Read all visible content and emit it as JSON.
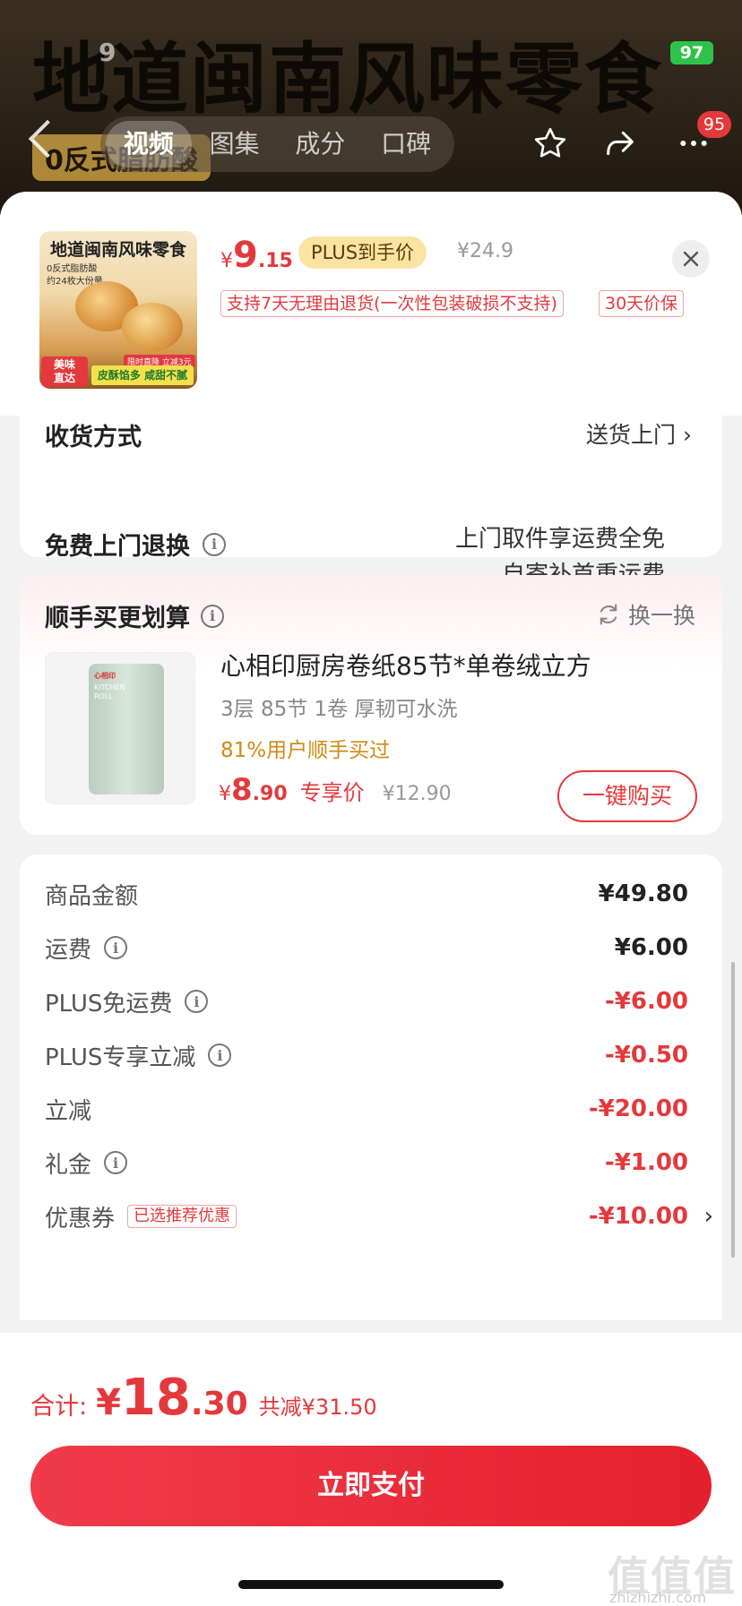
{
  "background": {
    "headline": "地道闽南风味零食",
    "subtag": "0反式脂肪酸",
    "status_time": "9",
    "battery": "97"
  },
  "nav": {
    "tabs": [
      {
        "label": "视频",
        "active": true
      },
      {
        "label": "图集",
        "active": false
      },
      {
        "label": "成分",
        "active": false
      },
      {
        "label": "口碑",
        "active": false
      }
    ],
    "badge_count": "95",
    "icons": [
      "back-icon",
      "star-icon",
      "share-icon",
      "more-icon"
    ]
  },
  "product": {
    "thumb_title": "地道闽南风味零食",
    "thumb_sub": "0反式脂肪酸\n约24枚大份量",
    "thumb_badge": "美味\n直达",
    "thumb_promo": "限时直降 立减3元",
    "thumb_foot": "皮酥馅多 咸甜不腻",
    "currency": "¥",
    "price_int": "9",
    "price_dec": ".15",
    "plus_tag": "PLUS到手价",
    "orig_price": "¥24.9",
    "policy_tags": [
      "支持7天无理由退货(一次性包装破损不支持)",
      "30天价保"
    ]
  },
  "shipping": {
    "cut_label": "收货方式",
    "cut_value": "送货上门 ›",
    "return_title": "免费上门退换",
    "return_lines": [
      "上门取件享运费全免",
      "自寄补首重运费"
    ]
  },
  "addon": {
    "title": "顺手买更划算",
    "swap_label": "换一换",
    "img_brand": "心相印",
    "img_label": "KITCHEN\nROLL",
    "name": "心相印厨房卷纸85节*单卷绒立方",
    "spec": "3层 85节 1卷 厚韧可水洗",
    "buyers": "81%用户顺手买过",
    "currency": "¥",
    "price_int": "8",
    "price_dec": ".90",
    "exclusive": "专享价",
    "orig_price": "¥12.90",
    "buy_button": "一键购买"
  },
  "amounts": [
    {
      "label": "商品金额",
      "value": "¥49.80",
      "info": false,
      "red": false
    },
    {
      "label": "运费",
      "value": "¥6.00",
      "info": true,
      "red": false
    },
    {
      "label": "PLUS免运费",
      "value": "-¥6.00",
      "info": true,
      "red": true
    },
    {
      "label": "PLUS专享立减",
      "value": "-¥0.50",
      "info": true,
      "red": true
    },
    {
      "label": "立减",
      "value": "-¥20.00",
      "info": false,
      "red": true
    },
    {
      "label": "礼金",
      "value": "-¥1.00",
      "info": true,
      "red": true
    },
    {
      "label": "优惠券",
      "value": "-¥10.00",
      "info": false,
      "red": true,
      "tag": "已选推荐优惠",
      "chevron": "›"
    }
  ],
  "footer": {
    "total_label": "合计:",
    "currency": "¥",
    "total_int": "18",
    "total_dec": ".30",
    "saved": "共减¥31.50",
    "pay_button": "立即支付",
    "watermark": "值值值",
    "watermark_sub": "zhizhizhi.com"
  },
  "colors": {
    "accent": "#e4393c",
    "gold": "#d08a14",
    "plus_bg": "#fbe3a2"
  }
}
